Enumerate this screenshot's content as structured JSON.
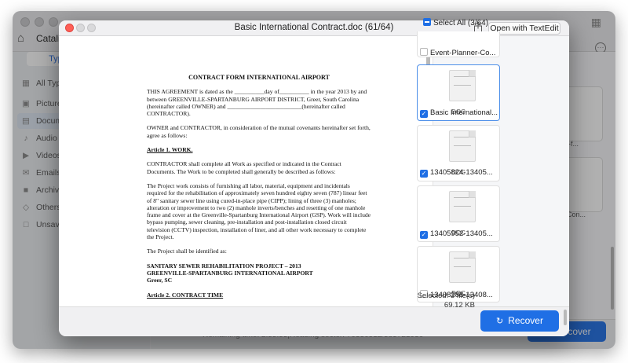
{
  "background_app": {
    "title": "Catali",
    "type_tab": "Type",
    "sidebar_items": [
      {
        "label": "All Type",
        "icon": "grid-icon"
      },
      {
        "label": "Pictures",
        "icon": "picture-icon"
      },
      {
        "label": "Docume",
        "icon": "document-icon"
      },
      {
        "label": "Audio",
        "icon": "music-icon"
      },
      {
        "label": "Videos",
        "icon": "video-icon"
      },
      {
        "label": "Emails",
        "icon": "mail-icon"
      },
      {
        "label": "Archive",
        "icon": "archive-icon"
      },
      {
        "label": "Others",
        "icon": "other-icon"
      },
      {
        "label": "Unsaved",
        "icon": "unsaved-icon"
      }
    ],
    "card_labels": [
      "pper-f...",
      "ner-Con..."
    ],
    "remaining_text": "Remaining time: 2:55:55|Reading sector: 70336512/585721936",
    "recover_label": "cover"
  },
  "dialog": {
    "title": "Basic International Contract.doc (61/64)",
    "open_with_label": "Open with TextEdit",
    "select_all_label": "Select All (3/64)",
    "footer": {
      "selected_count": "Selected: 3 file(s)",
      "selected_size": "69.12 KB",
      "recover_label": "Recover"
    },
    "files": [
      {
        "name": "Event-Planner-Co...",
        "checked": false,
        "selected": false,
        "badge": ""
      },
      {
        "name": "Basic International...",
        "checked": true,
        "selected": true,
        "badge": "DOC"
      },
      {
        "name": "13405824-13405...",
        "checked": true,
        "selected": false,
        "badge": "DOC"
      },
      {
        "name": "13405952-13405...",
        "checked": true,
        "selected": false,
        "badge": "DOC"
      },
      {
        "name": "13408288-13408...",
        "checked": false,
        "selected": false,
        "badge": "DOC"
      }
    ]
  },
  "document": {
    "title": "CONTRACT FORM INTERNATIONAL AIRPORT",
    "p1": "THIS AGREEMENT is dated as the __________day of__________ in the year 2013 by and between GREENVILLE-SPARTANBURG AIRPORT DISTRICT, Greer, South Carolina (hereinafter called OWNER) and _________________________(hereinafter called CONTRACTOR).",
    "p2": "OWNER and CONTRACTOR, in consideration of the mutual covenants hereinafter set forth, agree as follows:",
    "article1": "Article 1.  WORK.",
    "p3": "CONTRACTOR shall complete all Work as specified or indicated in the Contract Documents. The Work to be completed shall generally be described as follows:",
    "p4": "The Project work consists of furnishing all labor, material, equipment and incidentals required for the rehabilitation of approximately seven hundred eighty seven (787) linear feet of 8\" sanitary sewer line using cured-in-place pipe (CIPP); lining of three (3) manholes; alteration or improvement to two (2) manhole inverts/benches and resetting of one manhole frame and cover at the Greenville-Spartanburg International Airport (GSP). Work will include bypass pumping, sewer cleaning, pre-installation and post-installation closed circuit television (CCTV) inspection, installation of liner, and all other work necessary to complete the Project.",
    "p5": "The Project shall be identified as:",
    "project_line1": "SANITARY SEWER REHABILITATION PROJECT – 2013",
    "project_line2": "GREENVILLE-SPARTANBURG INTERNATIONAL AIRPORT",
    "project_line3": "Greer, SC",
    "article2": "Article 2.  CONTRACT TIME"
  }
}
